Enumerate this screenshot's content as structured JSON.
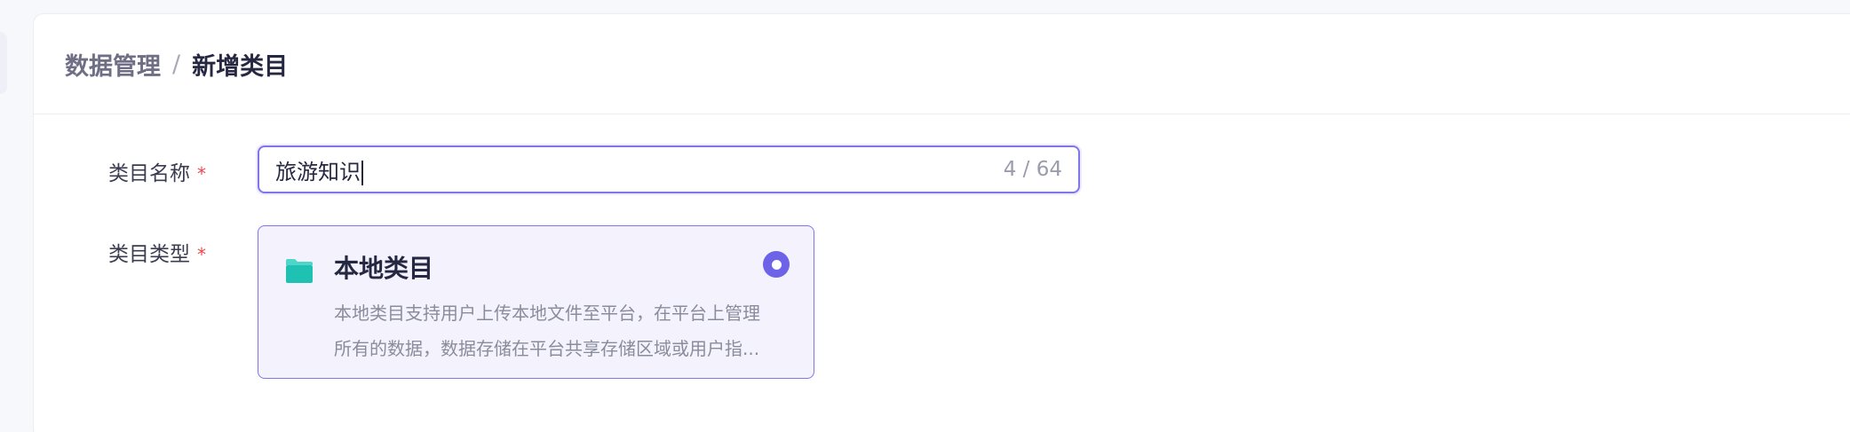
{
  "breadcrumb": {
    "parent": "数据管理",
    "separator": "/",
    "current": "新增类目"
  },
  "form": {
    "name_field": {
      "label": "类目名称",
      "required_mark": "*",
      "value": "旅游知识",
      "char_count": "4 / 64"
    },
    "type_field": {
      "label": "类目类型",
      "required_mark": "*",
      "option": {
        "icon": "folder-icon",
        "title": "本地类目",
        "description_line1": "本地类目支持用户上传本地文件至平台，在平台上管理",
        "description_line2": "所有的数据，数据存储在平台共享存储区域或用户指...",
        "selected": true
      }
    }
  },
  "colors": {
    "accent": "#6c63e8",
    "folder": "#1fc1b3",
    "required": "#e8484e"
  }
}
